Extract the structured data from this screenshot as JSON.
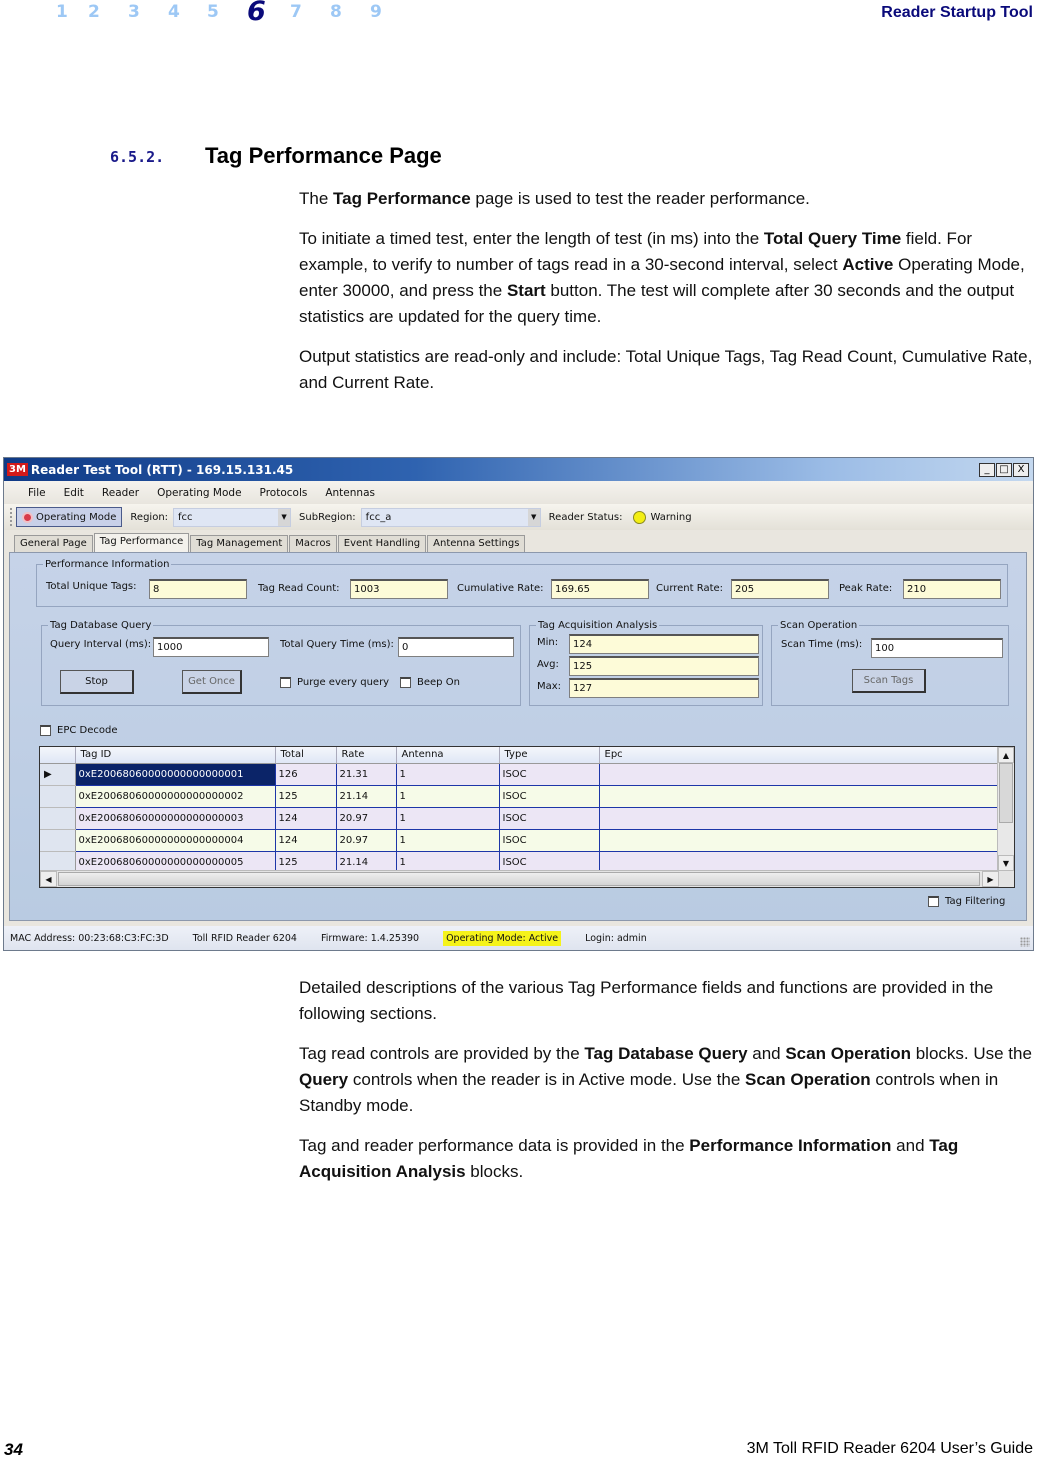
{
  "header": {
    "chapters": [
      "1",
      "2",
      "3",
      "4",
      "5",
      "6",
      "7",
      "8",
      "9"
    ],
    "active_chapter": "6",
    "running_title": "Reader Startup Tool"
  },
  "section": {
    "number": "6.5.2.",
    "title": "Tag Performance Page"
  },
  "intro": {
    "p1": [
      "The ",
      "Tag Performance",
      " page is used to test the reader performance."
    ],
    "p2": [
      "To initiate a timed test, enter the length of test (in ms) into the ",
      "Total Query Time",
      " field. For example, to verify to number of tags read in a 30-second interval, select ",
      "Active",
      " Operating Mode, enter 30000, and press the ",
      "Start",
      " button. The test will complete after 30 seconds and the output statistics are updated for the query time."
    ],
    "p3": "Output statistics are read-only and include: Total Unique Tags, Tag Read Count, Cumulative Rate, and Current Rate."
  },
  "app": {
    "logo": "3M",
    "title": "Reader Test Tool (RTT) - 169.15.131.45",
    "window_buttons": {
      "minimize": "_",
      "maximize": "□",
      "close": "X"
    },
    "menu": [
      "File",
      "Edit",
      "Reader",
      "Operating Mode",
      "Protocols",
      "Antennas"
    ],
    "toolbar": {
      "operating_mode_button": "Operating Mode",
      "region_label": "Region:",
      "region_value": "fcc",
      "subregion_label": "SubRegion:",
      "subregion_value": "fcc_a",
      "reader_status_label": "Reader Status:",
      "reader_status_value": "Warning",
      "status_color": "#f3ee14"
    },
    "tabs": [
      "General Page",
      "Tag Performance",
      "Tag Management",
      "Macros",
      "Event Handling",
      "Antenna Settings"
    ],
    "active_tab": "Tag Performance",
    "performance_info": {
      "legend": "Performance Information",
      "total_unique_tags_label": "Total Unique Tags:",
      "total_unique_tags": "8",
      "tag_read_count_label": "Tag Read Count:",
      "tag_read_count": "1003",
      "cumulative_rate_label": "Cumulative Rate:",
      "cumulative_rate": "169.65",
      "current_rate_label": "Current Rate:",
      "current_rate": "205",
      "peak_rate_label": "Peak Rate:",
      "peak_rate": "210"
    },
    "db_query": {
      "legend": "Tag Database Query",
      "query_interval_label": "Query Interval (ms):",
      "query_interval": "1000",
      "total_query_time_label": "Total Query Time (ms):",
      "total_query_time": "0",
      "stop_button": "Stop",
      "get_once_button": "Get Once",
      "purge_label": "Purge every query",
      "beep_label": "Beep On"
    },
    "acquisition": {
      "legend": "Tag Acquisition Analysis",
      "min_label": "Min:",
      "min": "124",
      "avg_label": "Avg:",
      "avg": "125",
      "max_label": "Max:",
      "max": "127"
    },
    "scan": {
      "legend": "Scan Operation",
      "scan_time_label": "Scan Time (ms):",
      "scan_time": "100",
      "scan_tags_button": "Scan Tags"
    },
    "epc_decode_label": "EPC Decode",
    "grid": {
      "columns": [
        "Tag ID",
        "Total",
        "Rate",
        "Antenna",
        "Type",
        "Epc"
      ],
      "rows": [
        [
          "0xE20068060000000000000001",
          "126",
          "21.31",
          "1",
          "ISOC",
          ""
        ],
        [
          "0xE20068060000000000000002",
          "125",
          "21.14",
          "1",
          "ISOC",
          ""
        ],
        [
          "0xE20068060000000000000003",
          "124",
          "20.97",
          "1",
          "ISOC",
          ""
        ],
        [
          "0xE20068060000000000000004",
          "124",
          "20.97",
          "1",
          "ISOC",
          ""
        ],
        [
          "0xE20068060000000000000005",
          "125",
          "21.14",
          "1",
          "ISOC",
          ""
        ]
      ],
      "current_row_marker": "▶"
    },
    "tag_filtering_label": "Tag Filtering",
    "statusbar": {
      "mac": "MAC Address: 00:23:68:C3:FC:3D",
      "device": "Toll RFID Reader 6204",
      "firmware": "Firmware: 1.4.25390",
      "operating_mode": "Operating Mode: Active",
      "login": "Login: admin"
    }
  },
  "after": {
    "p1": "Detailed descriptions of the various Tag Performance fields and functions are provided in the following sections.",
    "p2": [
      "Tag read controls are provided by the ",
      "Tag Database Query",
      " and ",
      "Scan Operation",
      " blocks. Use the ",
      "Query",
      " controls when the reader is in Active mode. Use the ",
      "Scan Operation",
      " controls when in Standby mode."
    ],
    "p3": [
      "Tag and reader performance data is provided in the ",
      "Performance Information",
      " and ",
      "Tag Acquisition Analysis",
      " blocks."
    ]
  },
  "footer": {
    "page_number": "34",
    "guide_title": "3M Toll RFID Reader 6204 User’s Guide"
  }
}
